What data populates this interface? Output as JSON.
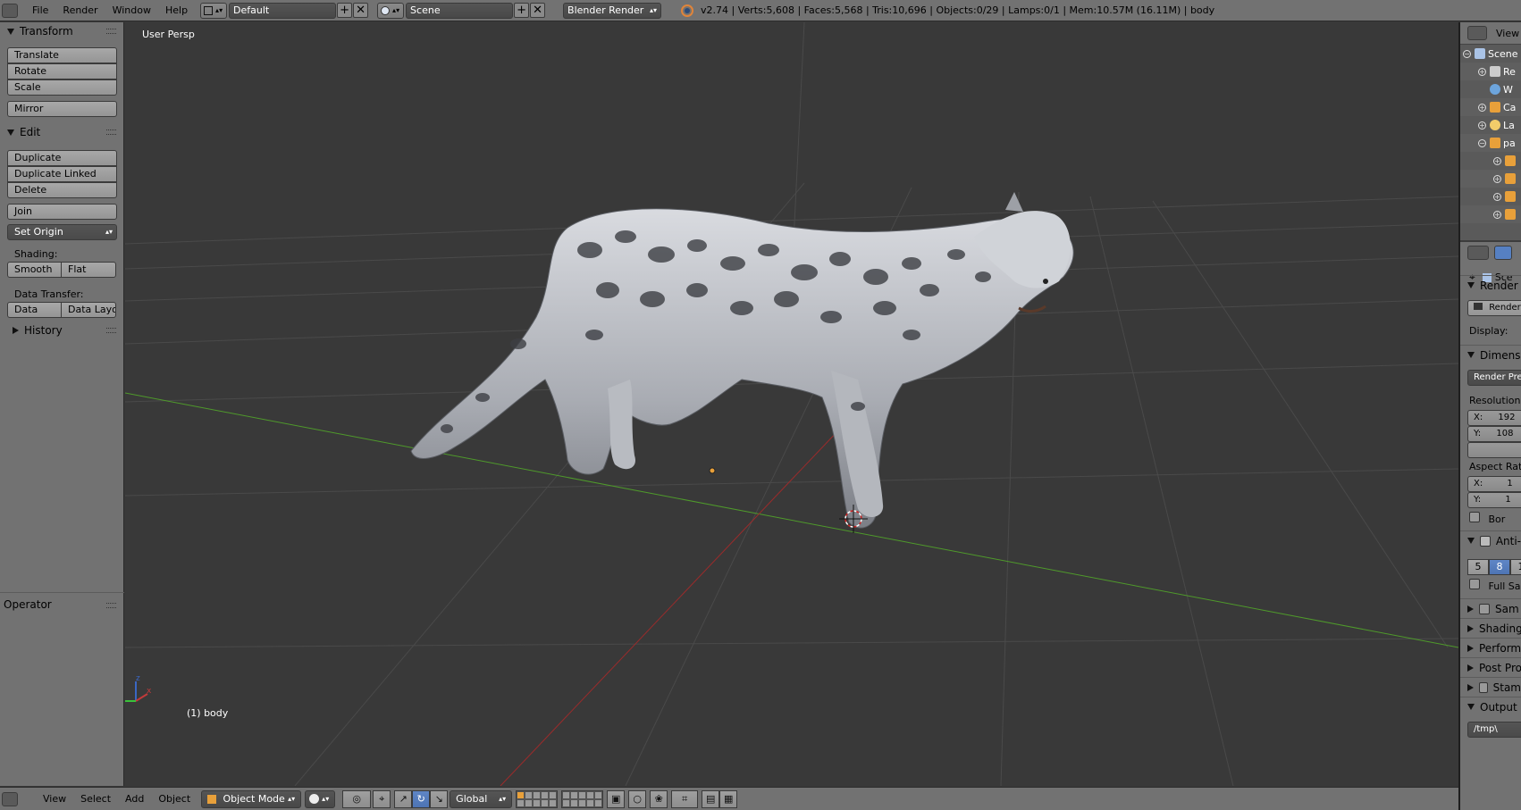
{
  "menubar": {
    "items": [
      "File",
      "Render",
      "Window",
      "Help"
    ],
    "layout_name": "Default",
    "scene_name": "Scene",
    "render_engine": "Blender Render",
    "stats": "v2.74 | Verts:5,608 | Faces:5,568 | Tris:10,696 | Objects:0/29 | Lamps:0/1 | Mem:10.57M (16.11M) | body"
  },
  "toolshelf": {
    "transform_title": "Transform",
    "translate": "Translate",
    "rotate": "Rotate",
    "scale": "Scale",
    "mirror": "Mirror",
    "edit_title": "Edit",
    "duplicate": "Duplicate",
    "duplicate_linked": "Duplicate Linked",
    "delete": "Delete",
    "join": "Join",
    "set_origin": "Set Origin",
    "shading_label": "Shading:",
    "smooth": "Smooth",
    "flat": "Flat",
    "data_transfer_label": "Data Transfer:",
    "data": "Data",
    "data_layout": "Data Layo",
    "history_title": "History",
    "operator_title": "Operator"
  },
  "viewport": {
    "view_label": "User Persp",
    "object_label": "(1) body"
  },
  "bottombar": {
    "view": "View",
    "select": "Select",
    "add": "Add",
    "object": "Object",
    "mode": "Object Mode",
    "orientation": "Global"
  },
  "outliner": {
    "header": "View",
    "rows": [
      "Scene",
      "Re",
      "W",
      "Ca",
      "La",
      "pa",
      "",
      "",
      "",
      ""
    ]
  },
  "properties": {
    "context": "Sce",
    "render_title": "Render",
    "render_btn": "Render",
    "display_label": "Display:",
    "dimensions_title": "Dimensi",
    "render_presets": "Render Pre",
    "resolution_label": "Resolution:",
    "res_x": "X:",
    "res_x_val": "192",
    "res_y": "Y:",
    "res_y_val": "108",
    "aspect_label": "Aspect Rat",
    "asp_x": "X:",
    "asp_x_val": "1",
    "asp_y": "Y:",
    "asp_y_val": "1",
    "border": "Bor",
    "anti_title": "Anti-",
    "aa_5": "5",
    "aa_8": "8",
    "aa_11": "1",
    "full_sample": "Full Sar",
    "sampled_motion": "Sam",
    "shading_title": "Shading",
    "performance_title": "Perform",
    "post_processing_title": "Post Pro",
    "stamp_title": "Stam",
    "output_title": "Output",
    "output_path": "/tmp\\"
  },
  "colors": {
    "ui_panel": "#727272",
    "viewport_bg": "#393939",
    "x_axis": "#9b2b2b",
    "y_axis": "#4f9a2b",
    "accent_blue": "#5680c2"
  }
}
